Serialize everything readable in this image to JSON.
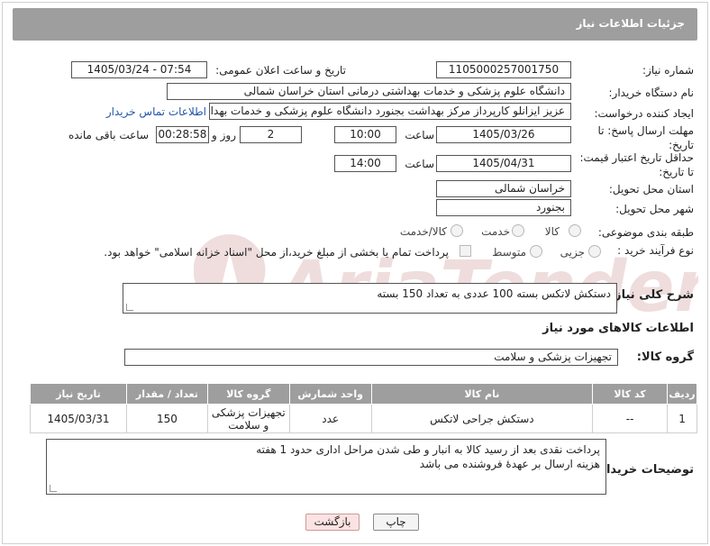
{
  "title": "جزئیات اطلاعات نیاز",
  "fields": {
    "need_number_label": "شماره نیاز:",
    "need_number": "1105000257001750",
    "announce_label": "تاریخ و ساعت اعلان عمومی:",
    "announce_value": "1405/03/24 - 07:54",
    "buyer_org_label": "نام دستگاه خریدار:",
    "buyer_org": "دانشگاه علوم پزشکی و خدمات بهداشتی درمانی استان خراسان شمالی",
    "creator_label": "ایجاد کننده درخواست:",
    "creator": "عزیز ایزانلو کارپرداز مرکز بهداشت بجنورد دانشگاه علوم پزشکی و خدمات بهداشت",
    "contact_link": "اطلاعات تماس خریدار",
    "deadline_label": "مهلت ارسال پاسخ: تا تاریخ:",
    "deadline_date": "1405/03/26",
    "time_label": "ساعت",
    "deadline_time": "10:00",
    "days_value": "2",
    "days_label": "روز و",
    "remaining_time": "00:28:58",
    "remaining_label": "ساعت باقی مانده",
    "validity_label": "حداقل تاریخ اعتبار قیمت: تا تاریخ:",
    "validity_date": "1405/04/31",
    "validity_time": "14:00",
    "province_label": "استان محل تحویل:",
    "province": "خراسان شمالی",
    "city_label": "شهر محل تحویل:",
    "city": "بجنورد",
    "category_label": "طبقه بندی موضوعی:",
    "category_options": [
      "کالا",
      "خدمت",
      "کالا/خدمت"
    ],
    "process_label": "نوع فرآیند خرید :",
    "process_options": [
      "جزیی",
      "متوسط"
    ],
    "payment_note": "پرداخت تمام یا بخشی از مبلغ خرید،از محل \"اسناد خزانه اسلامی\" خواهد بود."
  },
  "description": {
    "label": "شرح کلی نیاز:",
    "value": "دستکش لاتکس بسته 100 عددی به تعداد 150 بسته"
  },
  "goods_section_title": "اطلاعات کالاهای مورد نیاز",
  "goods_group": {
    "label": "گروه کالا:",
    "value": "تجهیزات پزشکی و سلامت"
  },
  "table": {
    "headers": [
      "ردیف",
      "کد کالا",
      "نام کالا",
      "واحد شمارش",
      "گروه کالا",
      "تعداد / مقدار",
      "تاریخ نیاز"
    ],
    "rows": [
      [
        "1",
        "--",
        "دستکش جراحی لاتکس",
        "عدد",
        "تجهیزات پزشکی و سلامت",
        "150",
        "1405/03/31"
      ]
    ]
  },
  "buyer_notes": {
    "label": "توضیحات خریدار:",
    "line1": "پرداخت نقدی بعد از رسید کالا به انبار و طی شدن مراحل اداری حدود 1 هفته",
    "line2": "هزینه ارسال بر عهدهٔ فروشنده می باشد"
  },
  "buttons": {
    "print": "چاپ",
    "back": "بازگشت"
  },
  "watermark_text": "AriaTender.net"
}
